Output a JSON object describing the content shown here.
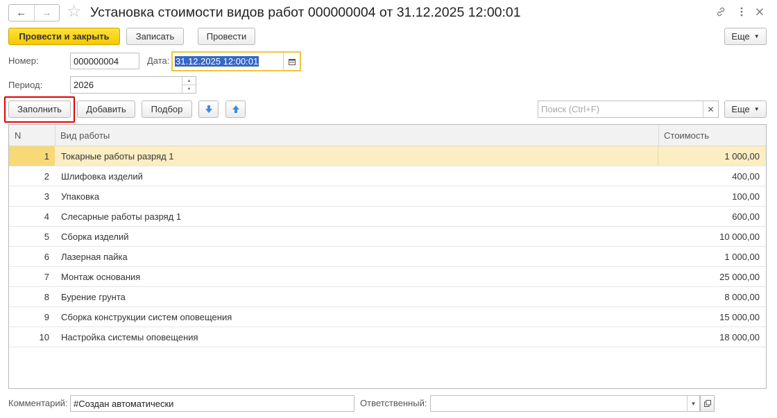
{
  "window": {
    "back_icon": "arrow-left-icon",
    "forward_icon": "arrow-right-icon",
    "favorite_icon": "star-icon",
    "title": "Установка стоимости видов работ 000000004 от 31.12.2025 12:00:01",
    "link_icon": "link-icon",
    "menu_icon": "more-vertical-icon",
    "close_icon": "close-icon"
  },
  "toolbar": {
    "post_and_close": "Провести и закрыть",
    "save": "Записать",
    "post": "Провести",
    "more": "Еще"
  },
  "form": {
    "number_label": "Номер:",
    "number_value": "000000004",
    "date_label": "Дата:",
    "date_value": "31.12.2025 12:00:01",
    "period_label": "Период:",
    "period_value": "2026",
    "comment_label": "Комментарий:",
    "comment_value": "#Создан автоматически",
    "responsible_label": "Ответственный:",
    "responsible_value": ""
  },
  "table_toolbar": {
    "fill": "Заполнить",
    "add": "Добавить",
    "pick": "Подбор",
    "move_down_icon": "arrow-down-icon",
    "move_up_icon": "arrow-up-icon",
    "search_placeholder": "Поиск (Ctrl+F)",
    "more": "Еще"
  },
  "table": {
    "columns": {
      "n": "N",
      "work": "Вид работы",
      "cost": "Стоимость"
    },
    "rows": [
      {
        "n": "1",
        "work": "Токарные работы разряд 1",
        "cost": "1 000,00"
      },
      {
        "n": "2",
        "work": "Шлифовка изделий",
        "cost": "400,00"
      },
      {
        "n": "3",
        "work": "Упаковка",
        "cost": "100,00"
      },
      {
        "n": "4",
        "work": "Слесарные работы разряд 1",
        "cost": "600,00"
      },
      {
        "n": "5",
        "work": "Сборка изделий",
        "cost": "10 000,00"
      },
      {
        "n": "6",
        "work": "Лазерная пайка",
        "cost": "1 000,00"
      },
      {
        "n": "7",
        "work": "Монтаж основания",
        "cost": "25 000,00"
      },
      {
        "n": "8",
        "work": "Бурение грунта",
        "cost": "8 000,00"
      },
      {
        "n": "9",
        "work": "Сборка конструкции систем оповещения",
        "cost": "15 000,00"
      },
      {
        "n": "10",
        "work": "Настройка системы оповещения",
        "cost": "18 000,00"
      }
    ],
    "selected_row": 1
  },
  "colors": {
    "primary_button": "#f6c800",
    "selected_row": "#fbeec2",
    "highlight_frame": "#e00000",
    "focus_border": "#f0c440",
    "text_selection": "#3567c5"
  }
}
